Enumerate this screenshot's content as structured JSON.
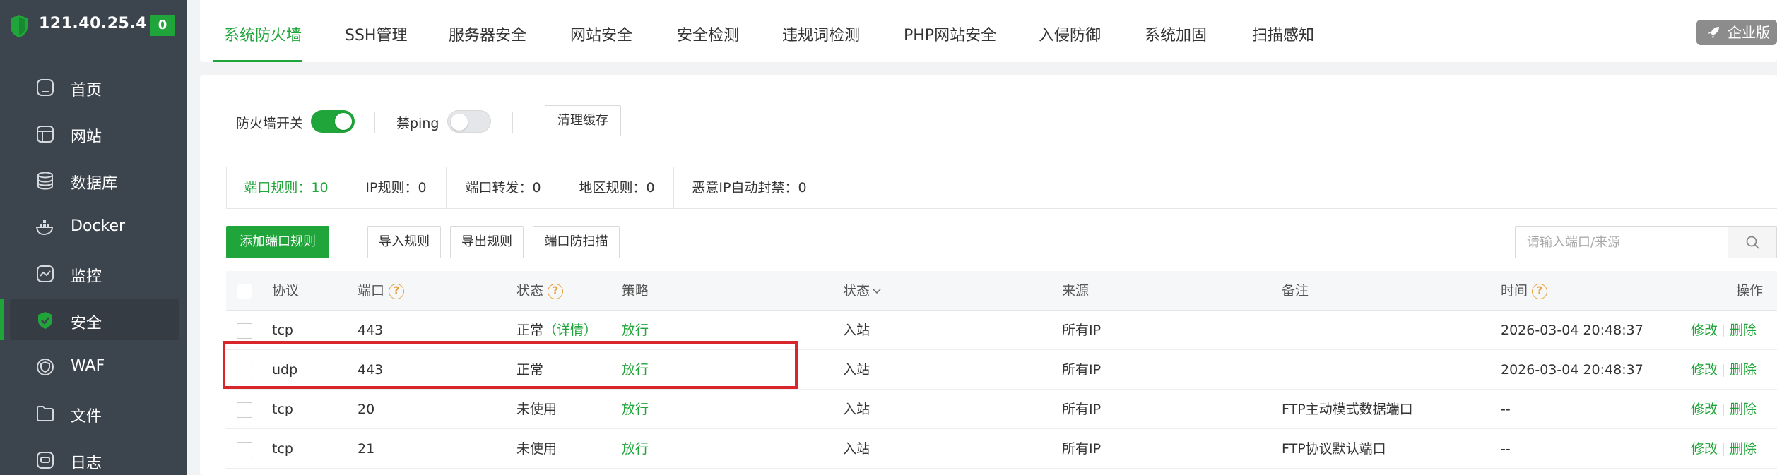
{
  "sidebar": {
    "server_ip": "121.40.25.4",
    "badge": "0",
    "items": [
      {
        "label": "首页",
        "icon": "home-icon"
      },
      {
        "label": "网站",
        "icon": "website-icon"
      },
      {
        "label": "数据库",
        "icon": "database-icon"
      },
      {
        "label": "Docker",
        "icon": "docker-icon"
      },
      {
        "label": "监控",
        "icon": "monitor-icon"
      },
      {
        "label": "安全",
        "icon": "security-shield-icon",
        "active": true
      },
      {
        "label": "WAF",
        "icon": "waf-icon"
      },
      {
        "label": "文件",
        "icon": "folder-icon"
      },
      {
        "label": "日志",
        "icon": "log-icon"
      }
    ]
  },
  "top_tabs": [
    "系统防火墙",
    "SSH管理",
    "服务器安全",
    "网站安全",
    "安全检测",
    "违规词检测",
    "PHP网站安全",
    "入侵防御",
    "系统加固",
    "扫描感知"
  ],
  "enterprise_label": "企业版",
  "controls": {
    "firewall_label": "防火墙开关",
    "firewall_on": true,
    "ping_label": "禁ping",
    "ping_on": false,
    "clear_cache": "清理缓存"
  },
  "sub_tabs": [
    "端口规则：10",
    "IP规则：0",
    "端口转发：0",
    "地区规则：0",
    "恶意IP自动封禁：0"
  ],
  "actions": {
    "add": "添加端口规则",
    "import": "导入规则",
    "export": "导出规则",
    "scan": "端口防扫描"
  },
  "search": {
    "placeholder": "请输入端口/来源"
  },
  "table": {
    "headers": {
      "protocol": "协议",
      "port": "端口",
      "status": "状态",
      "policy": "策略",
      "direction": "状态",
      "source": "来源",
      "remark": "备注",
      "time": "时间",
      "ops": "操作"
    },
    "rows": [
      {
        "protocol": "tcp",
        "port": "443",
        "status": "正常",
        "detail": "（详情）",
        "policy": "放行",
        "direction": "入站",
        "source": "所有IP",
        "remark": "",
        "time": "2026-03-04 20:48:37"
      },
      {
        "protocol": "udp",
        "port": "443",
        "status": "正常",
        "detail": "",
        "policy": "放行",
        "direction": "入站",
        "source": "所有IP",
        "remark": "",
        "time": "2026-03-04 20:48:37"
      },
      {
        "protocol": "tcp",
        "port": "20",
        "status": "未使用",
        "detail": "",
        "policy": "放行",
        "direction": "入站",
        "source": "所有IP",
        "remark": "FTP主动模式数据端口",
        "time": "--"
      },
      {
        "protocol": "tcp",
        "port": "21",
        "status": "未使用",
        "detail": "",
        "policy": "放行",
        "direction": "入站",
        "source": "所有IP",
        "remark": "FTP协议默认端口",
        "time": "--"
      }
    ],
    "edit": "修改",
    "delete": "删除"
  },
  "colors": {
    "accent": "#20a53a",
    "highlight": "#d9262c",
    "sidebar_bg": "#3c444d"
  }
}
